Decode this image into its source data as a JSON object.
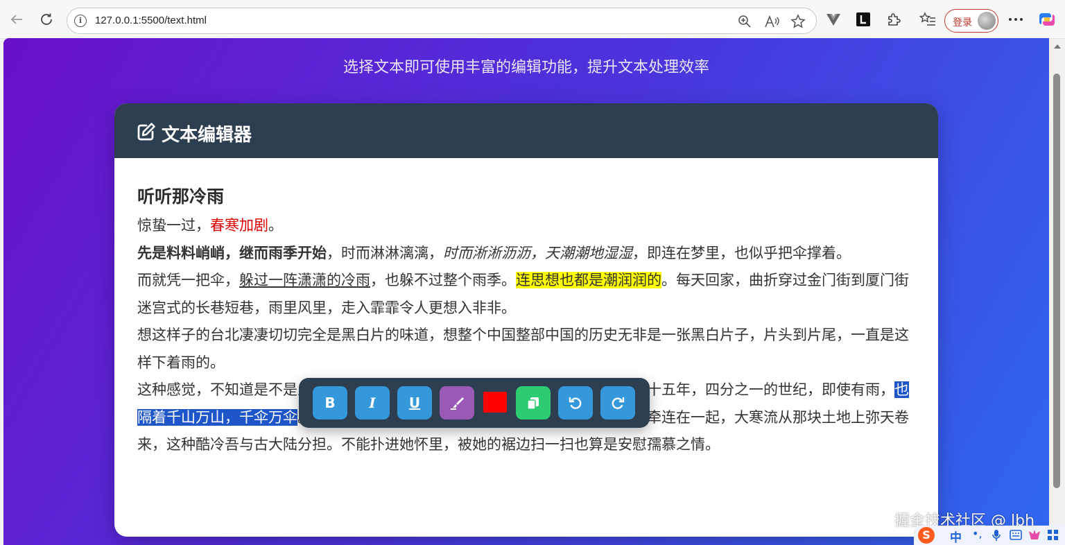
{
  "browser": {
    "url": "127.0.0.1:5500/text.html",
    "login_label": "登录"
  },
  "page": {
    "subtitle": "选择文本即可使用丰富的编辑功能，提升文本处理效率",
    "editor_title": "文本编辑器"
  },
  "content": {
    "heading": "听听那冷雨",
    "p1": {
      "a": "惊蛰一过，",
      "red": "春寒加剧",
      "b": "。"
    },
    "p2": {
      "bold": "先是料料峭峭，继而雨季开始",
      "a": "，时而淋淋漓漓，",
      "italic": "时而淅淅沥沥，天潮潮地湿湿",
      "b": "，即连在梦里，也似乎把伞撑着。"
    },
    "p3": {
      "a": "而就凭一把伞，",
      "underline": "躲过一阵潇潇的冷雨",
      "b": "，也躲不过整个雨季。",
      "highlight": "连思想也都是潮润润的",
      "c": "。每天回家，曲折穿过金门街到厦门街迷宫式的长巷短巷，雨里风里，走入霏霏令人更想入非非。"
    },
    "p4": "想这样子的台北凄凄切切完全是黑白片的味道，想整个中国整部中国的历史无非是一张黑白片子，片头到片尾，一直是这样下着雨的。",
    "p5": {
      "a": "这种感觉，不知道是不是从安东尼奥尼那里来的。不过那一块土地是久违了，二十五年，四分之一的世纪，即使有雨，",
      "selected": "也隔着千山万山，千伞万伞",
      "b": "。二十五年，一切都断了，只有气候，只有气象报告还牵连在一起，大寒流从那块土地上弥天卷来，这种酷冷吾与古大陆分担。不能扑进她怀里，被她的裾边扫一扫也算是安慰孺慕之情。"
    }
  },
  "toolbar": {
    "bold_label": "B",
    "italic_label": "I",
    "underline_label": "U",
    "highlight_icon": "highlighter-icon",
    "color_value": "#ff0000",
    "copy_icon": "copy-icon",
    "undo_icon": "undo-icon",
    "redo_icon": "redo-icon"
  },
  "overlay": {
    "watermark": "掘金技术社区 @ lbh",
    "ime_mode": "中",
    "ime_punct": "•,"
  },
  "colors": {
    "header_bg": "#2c3e50",
    "button_blue": "#3498db",
    "button_purple": "#9b59b6",
    "button_green": "#2ecc71",
    "selection": "#1e56c9",
    "highlight": "#ffff00"
  }
}
